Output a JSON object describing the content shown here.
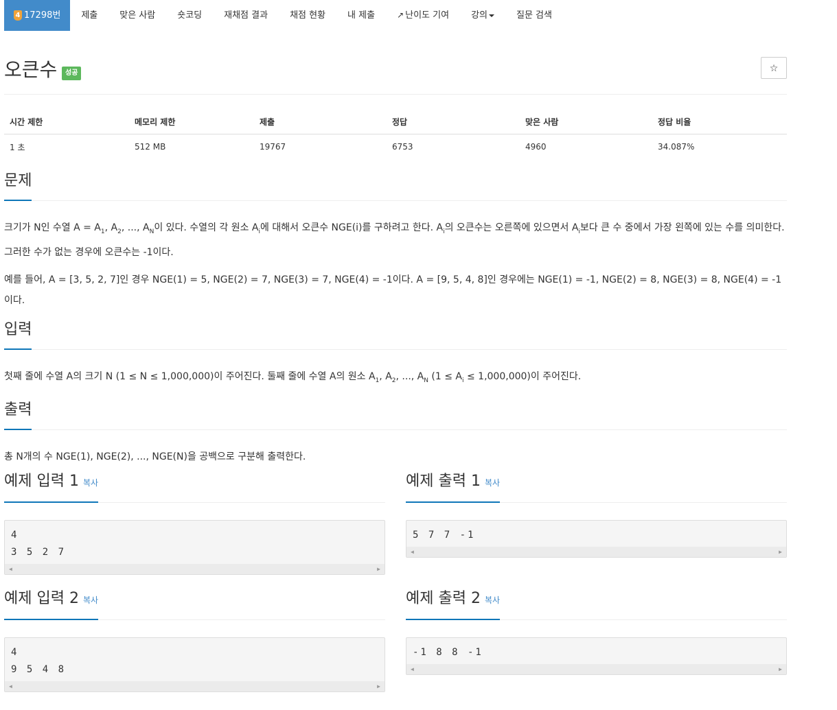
{
  "nav": {
    "problem_number": "17298번",
    "tier": "4",
    "items": [
      "제출",
      "맞은 사람",
      "숏코딩",
      "재채점 결과",
      "채점 현황",
      "내 제출"
    ],
    "difficulty": "난이도 기여",
    "lecture": "강의",
    "qna": "질문 검색"
  },
  "problem": {
    "title": "오큰수",
    "status": "성공",
    "star": "☆"
  },
  "info": {
    "headers": [
      "시간 제한",
      "메모리 제한",
      "제출",
      "정답",
      "맞은 사람",
      "정답 비율"
    ],
    "values": [
      "1 초",
      "512 MB",
      "19767",
      "6753",
      "4960",
      "34.087%"
    ]
  },
  "sections": {
    "problem": "문제",
    "input": "입력",
    "output": "출력"
  },
  "text": {
    "p1_a": "크기가 N인 수열 A = A",
    "p1_s1": "1",
    "p1_b": ", A",
    "p1_s2": "2",
    "p1_c": ", ..., A",
    "p1_sN": "N",
    "p1_d": "이 있다. 수열의 각 원소 A",
    "p1_si": "i",
    "p1_e": "에 대해서 오큰수 NGE(i)를 구하려고 한다. A",
    "p1_si2": "i",
    "p1_f": "의 오큰수는 오른쪽에 있으면서 A",
    "p1_si3": "i",
    "p1_g": "보다 큰 수 중에서 가장 왼쪽에 있는 수를 의미한다. 그러한 수가 없는 경우에 오큰수는 -1이다.",
    "p2": "예를 들어, A = [3, 5, 2, 7]인 경우 NGE(1) = 5, NGE(2) = 7, NGE(3) = 7, NGE(4) = -1이다. A = [9, 5, 4, 8]인 경우에는 NGE(1) = -1, NGE(2) = 8, NGE(3) = 8, NGE(4) = -1이다.",
    "in_a": "첫째 줄에 수열 A의 크기 N (1 ≤ N ≤ 1,000,000)이 주어진다. 둘째 줄에 수열 A의 원소 A",
    "in_s1": "1",
    "in_b": ", A",
    "in_s2": "2",
    "in_c": ", ..., A",
    "in_sN": "N",
    "in_d": " (1 ≤ A",
    "in_si": "i",
    "in_e": " ≤ 1,000,000)이 주어진다.",
    "out": "총 N개의 수 NGE(1), NGE(2), ..., NGE(N)을 공백으로 구분해 출력한다."
  },
  "samples": {
    "copy": "복사",
    "in1_title": "예제 입력 1",
    "out1_title": "예제 출력 1",
    "in2_title": "예제 입력 2",
    "out2_title": "예제 출력 2",
    "in1": [
      "4",
      "3 5 2 7"
    ],
    "out1": [
      "5 7 7 -1"
    ],
    "in2": [
      "4",
      "9 5 4 8"
    ],
    "out2": [
      "-1 8 8 -1"
    ]
  },
  "colors": {
    "accent": "#428bca",
    "success": "#5cb85c",
    "underline": "#0e76b8",
    "tier": "#f0a33a"
  }
}
